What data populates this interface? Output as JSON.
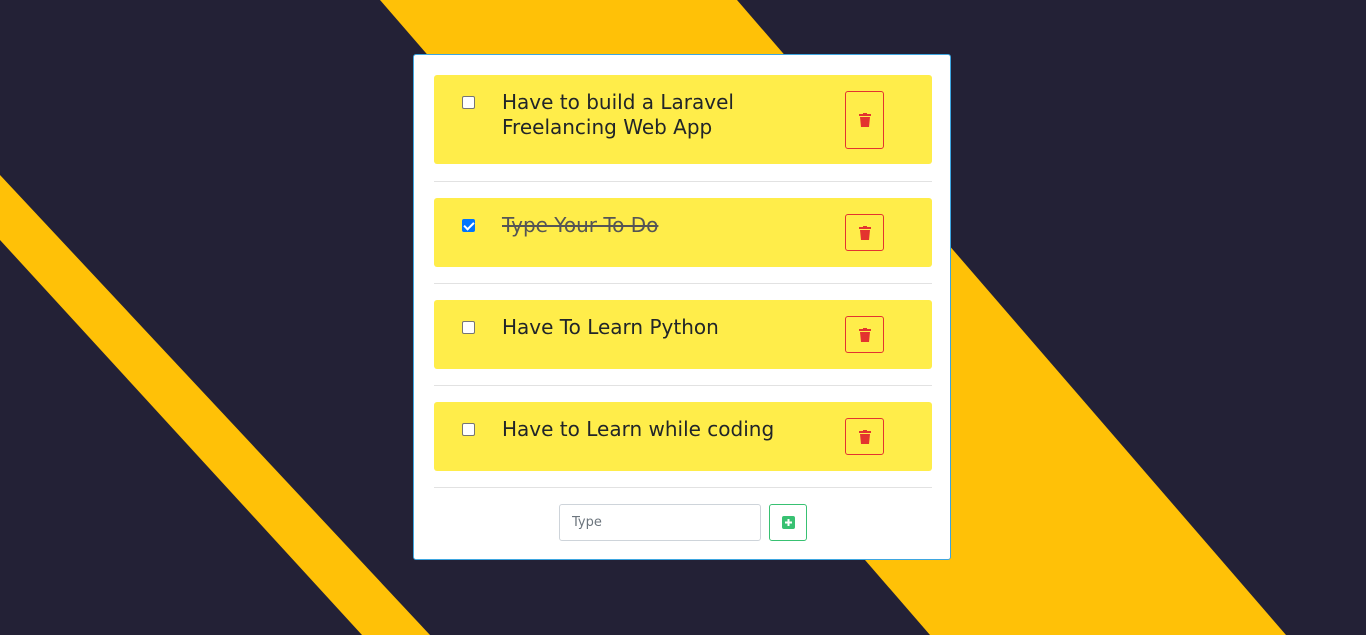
{
  "colors": {
    "background": "#232136",
    "stripe": "#ffc107",
    "item_background": "#ffed4a",
    "delete_red": "#e3342f",
    "add_green": "#38c172",
    "card_border": "#3ea6e0"
  },
  "todos": [
    {
      "text": "Have to build a Laravel Freelancing Web App",
      "done": false,
      "delete_icon": "trash-icon"
    },
    {
      "text": "Type Your To Do",
      "done": true,
      "delete_icon": "trash-icon"
    },
    {
      "text": "Have To Learn Python",
      "done": false,
      "delete_icon": "trash-icon"
    },
    {
      "text": "Have to Learn while coding",
      "done": false,
      "delete_icon": "trash-icon"
    }
  ],
  "form": {
    "input_placeholder": "Type",
    "input_value": "",
    "add_icon": "plus-square-icon"
  }
}
